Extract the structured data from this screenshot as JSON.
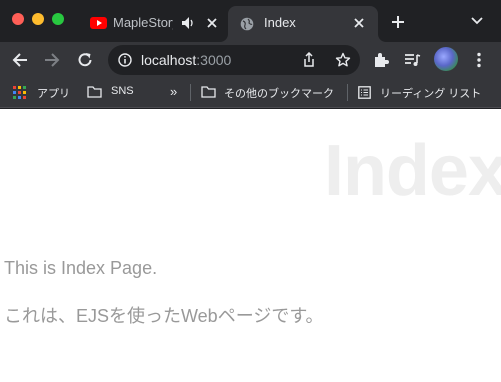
{
  "window": {
    "tabs": [
      {
        "title": "MapleStory",
        "icon": "youtube-icon",
        "audio": "speaker-icon",
        "active": false
      },
      {
        "title": "Index",
        "icon": "globe-icon",
        "active": true
      }
    ]
  },
  "toolbar": {
    "url_host": "localhost",
    "url_port": ":3000"
  },
  "bookmarks": {
    "apps": "アプリ",
    "sns": "SNS",
    "overflow": "»",
    "other": "その他のブックマーク",
    "reading_list": "リーディング リスト"
  },
  "page": {
    "heading": "Index",
    "paragraph1": "This is Index Page.",
    "paragraph2": "これは、EJSを使ったWebページです。"
  },
  "colors": {
    "chrome_dark": "#202124",
    "toolbar": "#35363a",
    "heading": "#eeeeee",
    "body_text": "#999999",
    "youtube_red": "#ff0000"
  }
}
